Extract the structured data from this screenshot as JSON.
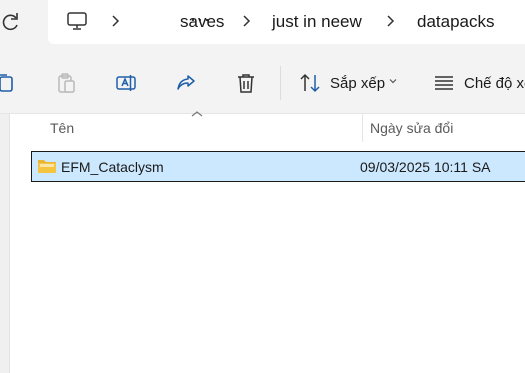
{
  "address_bar": {
    "overflow_label": "···",
    "crumbs": [
      "saves",
      "just in neew",
      "datapacks"
    ]
  },
  "toolbar": {
    "sort_label": "Sắp xếp",
    "view_label": "Chế độ xe"
  },
  "columns": {
    "name": "Tên",
    "date_modified": "Ngày sửa đổi"
  },
  "files": [
    {
      "name": "EFM_Cataclysm",
      "date_modified": "09/03/2025 10:11 SA",
      "type": "folder",
      "selected": true
    }
  ],
  "colors": {
    "selection_bg": "#cce8ff",
    "toolbar_bg": "#f3f3f3",
    "folder_yellow": "#f5c542",
    "share_blue": "#1f5fa8"
  }
}
